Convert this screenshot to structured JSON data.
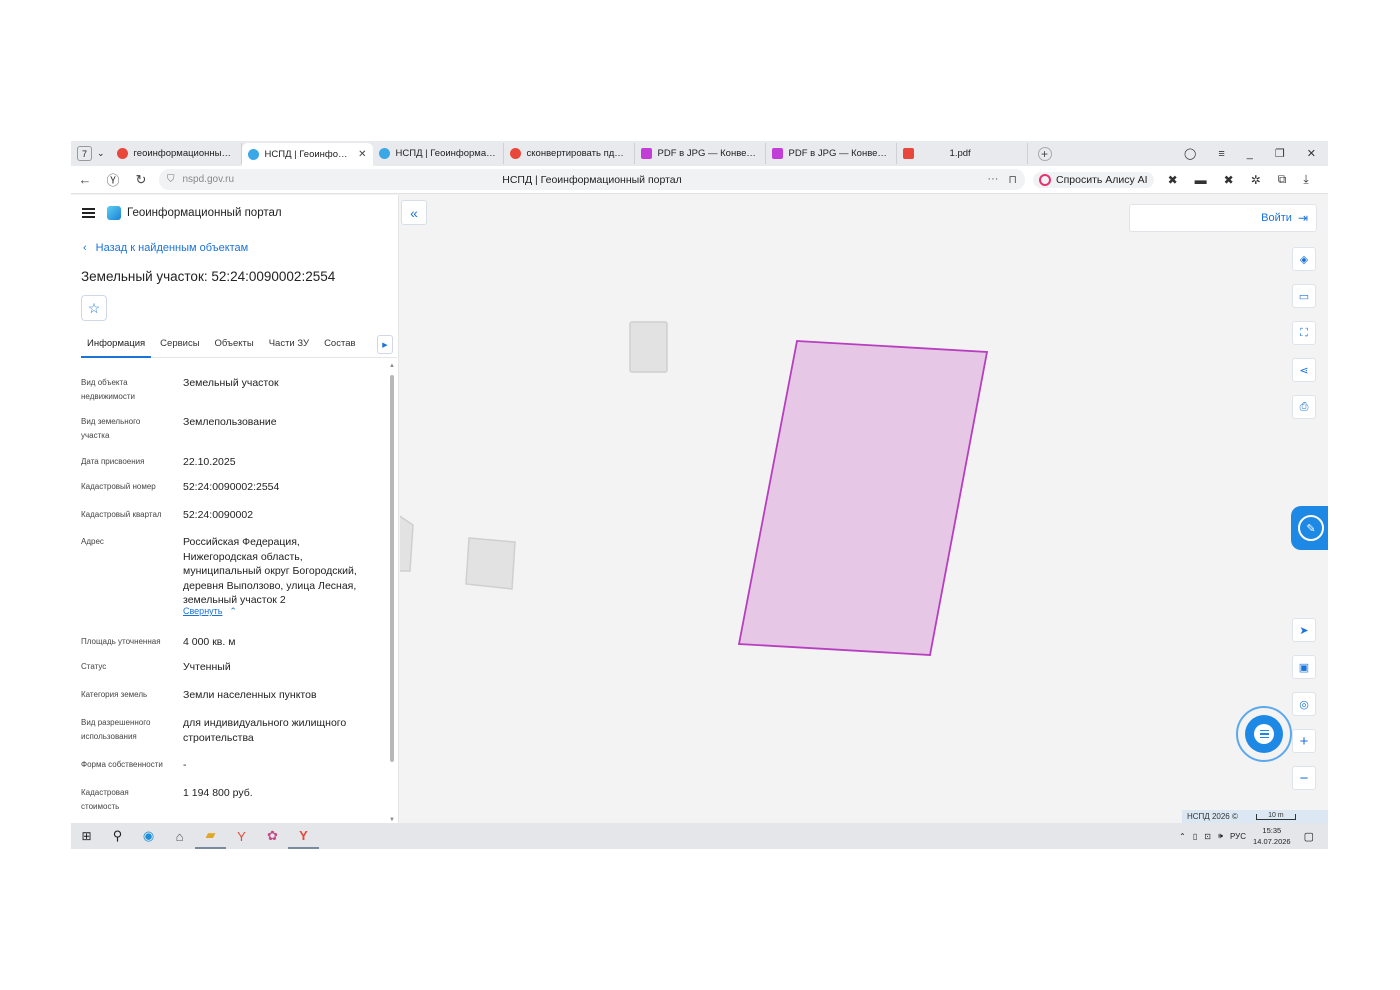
{
  "browser": {
    "tab_counter": "7",
    "tabs": [
      {
        "title": "геоинформационный пор",
        "favicon_color": "#e9473a"
      },
      {
        "title": "НСПД | Геоинформаци",
        "favicon_color": "#3aa7e6",
        "active": true
      },
      {
        "title": "НСПД | Геоинформацион",
        "favicon_color": "#3aa7e6"
      },
      {
        "title": "сконвертировать пдф в jp",
        "favicon_color": "#e9473a"
      },
      {
        "title": "PDF в JPG — Конвертиру",
        "favicon_color": "#c13fd6"
      },
      {
        "title": "PDF в JPG — Конвертиру",
        "favicon_color": "#c13fd6"
      },
      {
        "title": "1.pdf",
        "favicon_color": "#e9473a"
      }
    ],
    "url_host": "nspd.gov.ru",
    "page_title": "НСПД | Геоинформационный портал",
    "alice_label": "Спросить Алису AI"
  },
  "portal": {
    "header_title": "Геоинформационный портал",
    "back_link": "Назад к найденным объектам",
    "object_title": "Земельный участок: 52:24:0090002:2554",
    "tabs": [
      "Информация",
      "Сервисы",
      "Объекты",
      "Части ЗУ",
      "Состав"
    ],
    "collapse_label": "Свернуть",
    "attributes": [
      {
        "key": "Вид объекта недвижимости",
        "value": "Земельный участок"
      },
      {
        "key": "Вид земельного участка",
        "value": "Землепользование"
      },
      {
        "key": "Дата присвоения",
        "value": "22.10.2025"
      },
      {
        "key": "Кадастровый номер",
        "value": "52:24:0090002:2554"
      },
      {
        "key": "Кадастровый квартал",
        "value": "52:24:0090002"
      },
      {
        "key": "Адрес",
        "value": "Российская Федерация, Нижегородская область, муниципальный округ Богородский, деревня Выползово, улица Лесная, земельный участок 2"
      },
      {
        "key": "Площадь уточненная",
        "value": "4 000 кв. м"
      },
      {
        "key": "Статус",
        "value": "Учтенный"
      },
      {
        "key": "Категория земель",
        "value": "Земли населенных пунктов"
      },
      {
        "key": "Вид разрешенного использования",
        "value": "для индивидуального жилищного строительства"
      },
      {
        "key": "Форма собственности",
        "value": "-"
      },
      {
        "key": "Кадастровая стоимость",
        "value": "1 194 800 руб."
      }
    ]
  },
  "map": {
    "login_label": "Войти",
    "credit": "НСПД 2026 ©",
    "scale_label": "10 m",
    "parcel_fill": "#e6c8e6",
    "parcel_stroke": "#b73fbf",
    "accent": "#1a73d9"
  },
  "taskbar": {
    "lang": "РУС",
    "time": "15:35",
    "date": "14.07.2026"
  }
}
